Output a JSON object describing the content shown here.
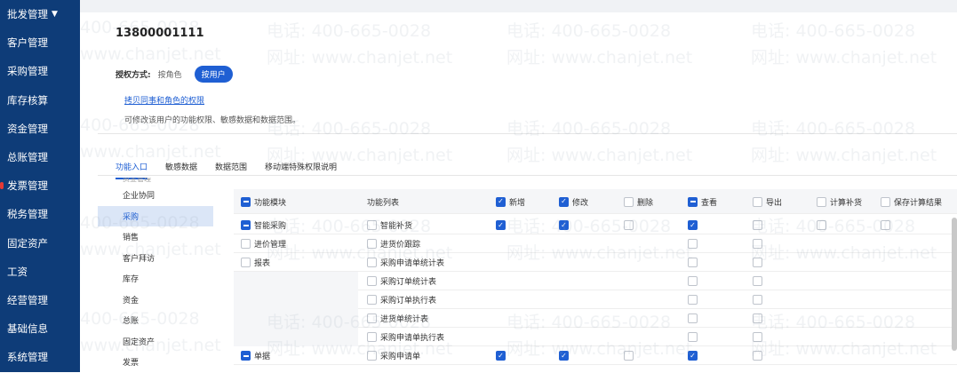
{
  "sidebar": {
    "items": [
      {
        "label": "批发管理",
        "caret": "▼"
      },
      {
        "label": "客户管理"
      },
      {
        "label": "采购管理"
      },
      {
        "label": "库存核算"
      },
      {
        "label": "资金管理"
      },
      {
        "label": "总账管理"
      },
      {
        "label": "发票管理"
      },
      {
        "label": "税务管理"
      },
      {
        "label": "固定资产"
      },
      {
        "label": "工资"
      },
      {
        "label": "经营管理"
      },
      {
        "label": "基础信息"
      },
      {
        "label": "系统管理"
      }
    ]
  },
  "header": {
    "phone": "13800001111",
    "auth_label": "授权方式:",
    "auth_by_role": "按角色",
    "auth_by_user": "按用户",
    "copy_link": "拷贝同事和角色的权限",
    "hint": "可修改该用户的功能权限、敏感数据和数据范围。"
  },
  "tabs": [
    {
      "label": "功能入口"
    },
    {
      "label": "敏感数据"
    },
    {
      "label": "数据范围"
    },
    {
      "label": "移动端特殊权限说明"
    }
  ],
  "leftnav": {
    "cut_label": "资金管理",
    "items": [
      {
        "label": "企业协同"
      },
      {
        "label": "采购"
      },
      {
        "label": "销售"
      },
      {
        "label": "客户拜访"
      },
      {
        "label": "库存"
      },
      {
        "label": "资金"
      },
      {
        "label": "总账"
      },
      {
        "label": "固定资产"
      },
      {
        "label": "发票"
      }
    ]
  },
  "grid": {
    "header": {
      "module": "功能模块",
      "list": "功能列表",
      "add": "新增",
      "edit": "修改",
      "delete": "删除",
      "view": "查看",
      "export": "导出",
      "calc": "计算补货",
      "save": "保存计算结果"
    },
    "rows": [
      {
        "module": "智能采购",
        "module_cb": "partial",
        "list": "智能补货",
        "add": "checked",
        "edit": "checked",
        "delete": "none",
        "view": "checked",
        "export": "none",
        "calc": "none",
        "save": "none"
      },
      {
        "module": "进价管理",
        "module_cb": "none",
        "list": "进货价跟踪",
        "add": "",
        "edit": "",
        "delete": "",
        "view": "none",
        "export": "none",
        "calc": "",
        "save": ""
      },
      {
        "module": "报表",
        "module_cb": "none",
        "list": "采购申请单统计表",
        "add": "",
        "edit": "",
        "delete": "",
        "view": "none",
        "export": "none",
        "calc": "",
        "save": ""
      },
      {
        "module": "",
        "module_cb": "",
        "list": "采购订单统计表",
        "add": "",
        "edit": "",
        "delete": "",
        "view": "none",
        "export": "none",
        "calc": "",
        "save": ""
      },
      {
        "module": "",
        "module_cb": "",
        "list": "采购订单执行表",
        "add": "",
        "edit": "",
        "delete": "",
        "view": "none",
        "export": "none",
        "calc": "",
        "save": ""
      },
      {
        "module": "",
        "module_cb": "",
        "list": "进货单统计表",
        "add": "",
        "edit": "",
        "delete": "",
        "view": "none",
        "export": "none",
        "calc": "",
        "save": ""
      },
      {
        "module": "",
        "module_cb": "",
        "list": "采购申请单执行表",
        "add": "",
        "edit": "",
        "delete": "",
        "view": "none",
        "export": "none",
        "calc": "",
        "save": ""
      },
      {
        "module": "单据",
        "module_cb": "partial",
        "list": "采购申请单",
        "add": "checked",
        "edit": "checked",
        "delete": "none",
        "view": "checked",
        "export": "none",
        "calc": "",
        "save": ""
      }
    ]
  },
  "watermark": {
    "phone": "电话: 400-665-0028",
    "site": "网址: www.chanjet.net",
    "phone_short": "400-665-0028",
    "site_short": "www.chanjet.net"
  },
  "colors": {
    "sidebar_bg": "#0e3c78",
    "accent": "#1f5fd3",
    "active_nav_bg": "#dbe6f7"
  }
}
